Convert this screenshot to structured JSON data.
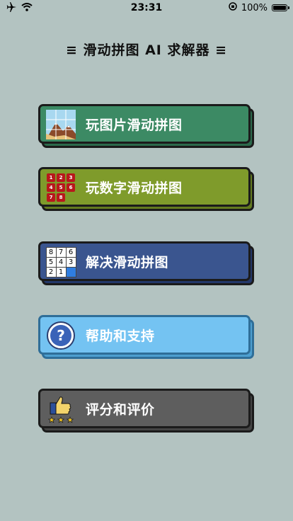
{
  "status_bar": {
    "time": "23:31",
    "battery_percent": "100%",
    "icons": [
      "airplane-icon",
      "wifi-icon",
      "orientation-lock-icon",
      "battery-icon"
    ]
  },
  "page": {
    "title": "≡ 滑动拼图 AI 求解器 ≡"
  },
  "menu": {
    "items": [
      {
        "label": "玩图片滑动拼图",
        "color": "#3c8a64",
        "shadow": "#2c6a4c",
        "icon": "mountain-picture-icon"
      },
      {
        "label": "玩数字滑动拼图",
        "color": "#7f9b2b",
        "shadow": "#637a20",
        "icon": "number-tiles-icon"
      },
      {
        "label": "解决滑动拼图",
        "color": "#3a558f",
        "shadow": "#24386a",
        "icon": "puzzle-grid-icon"
      },
      {
        "label": "帮助和支持",
        "color": "#74c3f2",
        "shadow": "#4d9fd0",
        "icon": "question-mark-icon"
      },
      {
        "label": "评分和评价",
        "color": "#5e5e5e",
        "shadow": "#444444",
        "icon": "thumbs-up-stars-icon"
      }
    ]
  },
  "number_tiles": [
    "1",
    "2",
    "3",
    "4",
    "5",
    "6",
    "7",
    "8"
  ],
  "solve_tiles": [
    "8",
    "7",
    "6",
    "5",
    "4",
    "3",
    "2",
    "1",
    ""
  ]
}
